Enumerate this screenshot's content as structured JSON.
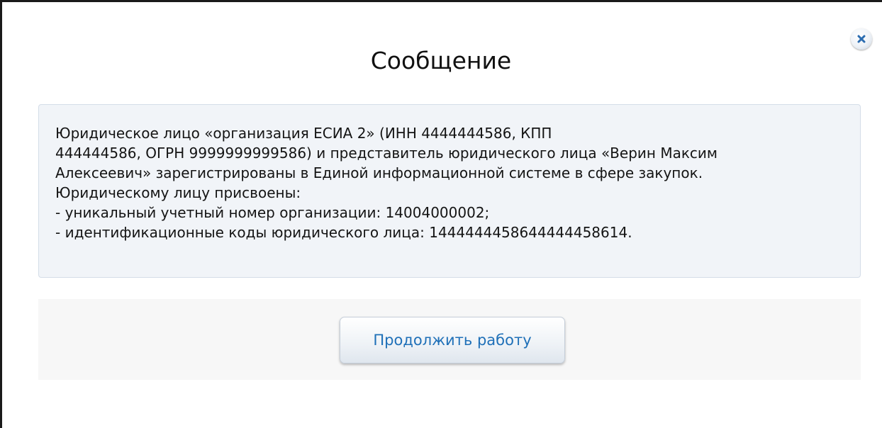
{
  "dialog": {
    "title": "Сообщение",
    "close_icon": "close-icon",
    "message_lines": [
      "Юридическое лицо «организация ЕСИА 2» (ИНН 4444444586, КПП",
      "444444586, ОГРН 9999999999586) и представитель юридического лица «Верин Максим",
      "Алексеевич» зарегистрированы в Единой информационной системе в сфере закупок.",
      "Юридическому лицу присвоены:",
      "- уникальный учетный номер организации: 14004000002;",
      "- идентификационные коды юридического лица: 1444444458644444458614."
    ],
    "continue_label": "Продолжить работу"
  },
  "colors": {
    "accent": "#1f70b8",
    "close_icon": "#2b6cb0",
    "message_bg": "#f1f4f8",
    "footer_bg": "#f7f7f7"
  }
}
